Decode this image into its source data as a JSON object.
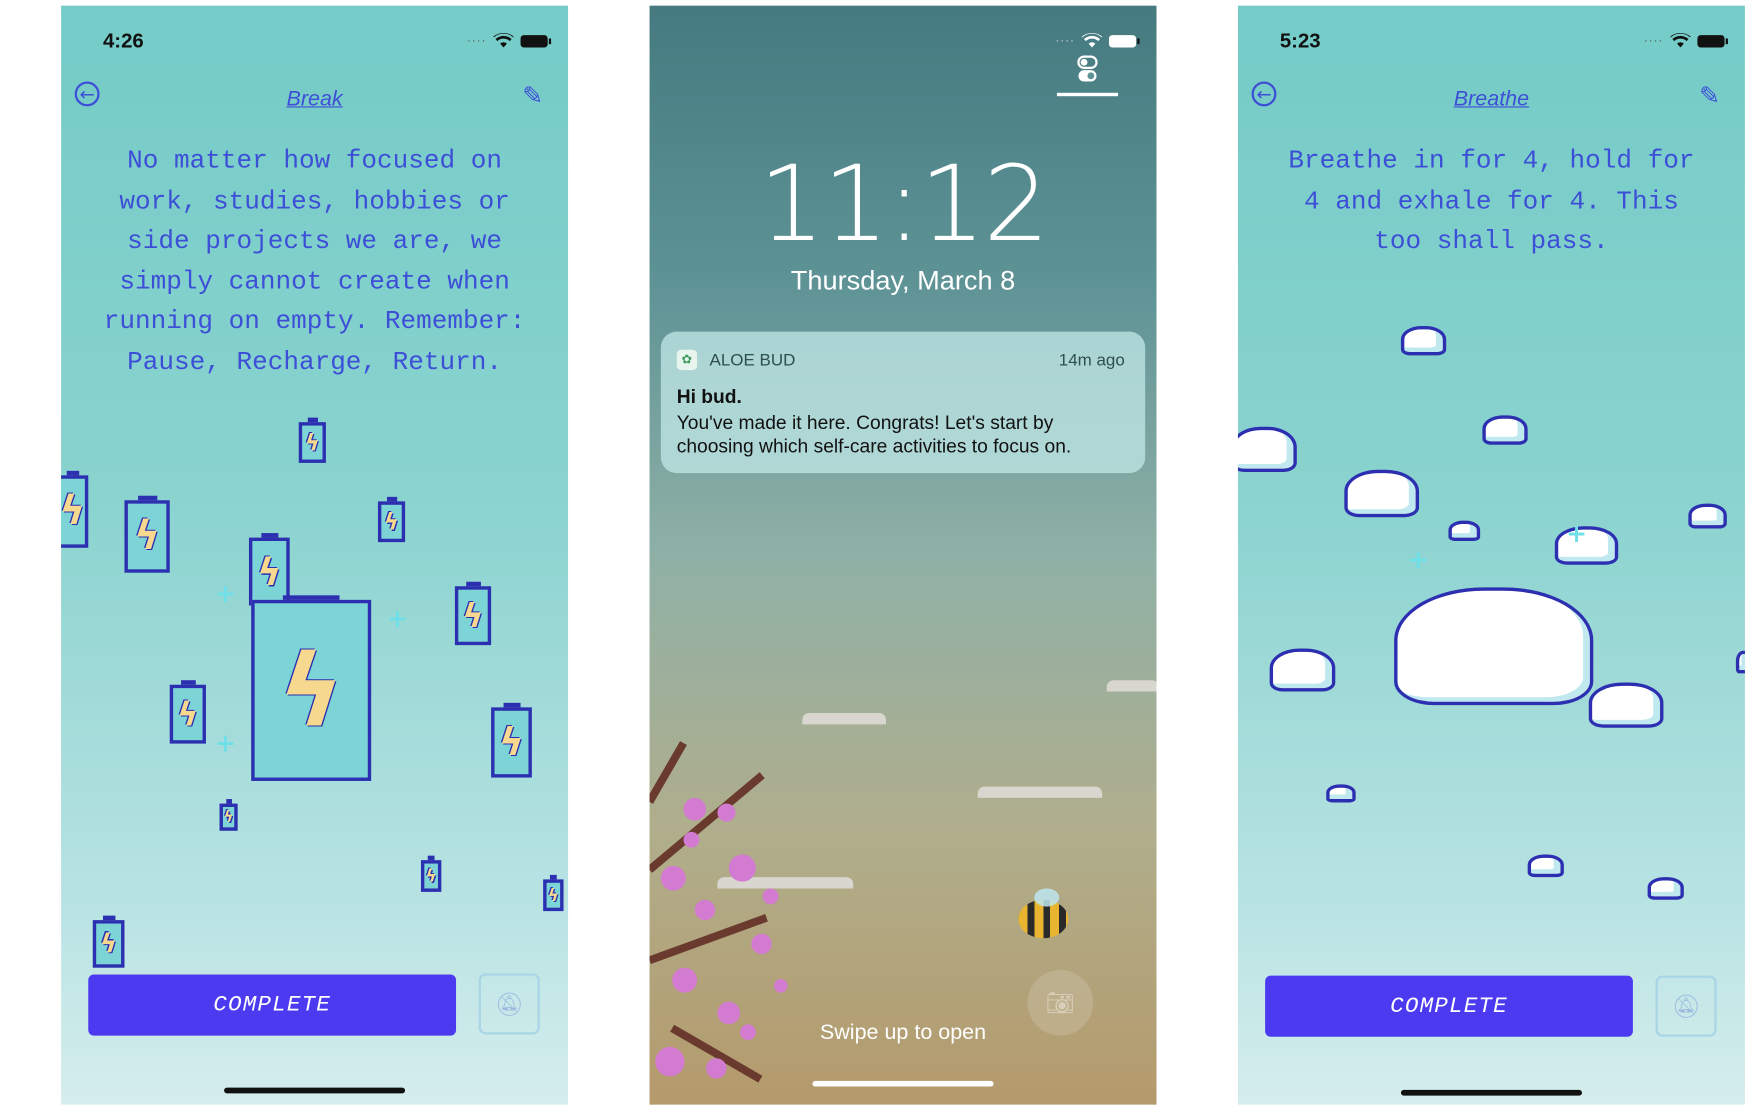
{
  "screens": {
    "break": {
      "status_time": "4:26",
      "title": "Break",
      "quote_lines": [
        "No matter how focused on",
        "work, studies, hobbies or",
        "side projects we are, we",
        "simply cannot create when",
        "running on empty. Remember:",
        "Pause, Recharge, Return."
      ],
      "complete_label": "COMPLETE",
      "icons": [
        "back-arrow-icon",
        "pencil-icon",
        "bell-off-icon",
        "battery-icon"
      ]
    },
    "lock": {
      "time": "11:12",
      "date": "Thursday, March 8",
      "notification": {
        "app": "ALOE BUD",
        "age": "14m ago",
        "title": "Hi bud.",
        "body": "You've made it here. Congrats! Let's start by choosing which self-care activities to focus on."
      },
      "swipe_hint": "Swipe up to open",
      "icons": [
        "camera-icon",
        "toggle-icon",
        "aloe-app-icon"
      ]
    },
    "breathe": {
      "status_time": "5:23",
      "title": "Breathe",
      "quote_lines": [
        "Breathe in for 4, hold for",
        "4 and exhale for 4. This",
        "too shall pass."
      ],
      "complete_label": "COMPLETE",
      "icons": [
        "back-arrow-icon",
        "pencil-icon",
        "bell-off-icon",
        "cloud-icon"
      ]
    }
  },
  "colors": {
    "accent": "#4b3af0",
    "text": "#3d4fd6",
    "bg_top": "#74cbc7",
    "bg_bottom": "#d5eded"
  }
}
